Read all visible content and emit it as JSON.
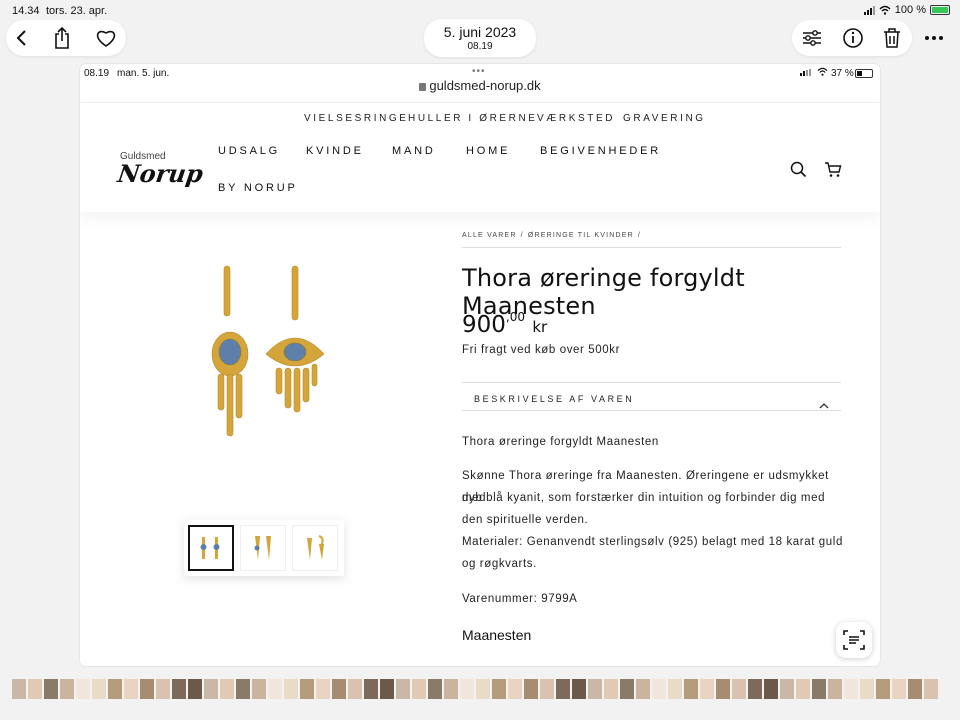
{
  "ipad_status": {
    "time": "14.34",
    "date": "tors. 23. apr.",
    "battery": "100 %"
  },
  "photos_toolbar": {
    "date_title": "5. juni 2023",
    "time_sub": "08.19",
    "left_icons": [
      "back-icon",
      "share-icon",
      "heart-icon"
    ],
    "right_icons": [
      "adjust-icon",
      "info-icon",
      "trash-icon",
      "more-icon"
    ]
  },
  "screenshot": {
    "status": {
      "time": "08.19",
      "date": "man. 5. jun.",
      "battery": "37 %"
    },
    "url": "guldsmed-norup.dk",
    "top_nav": [
      "VIELSESRINGE",
      "HULLER I ØRERNE",
      "VÆRKSTED",
      "GRAVERING"
    ],
    "main_nav": [
      "UDSALG",
      "KVINDE",
      "MAND",
      "HOME",
      "BEGIVENHEDER",
      "BY NORUP"
    ],
    "logo": {
      "small": "Guldsmed",
      "big": "Norup"
    },
    "breadcrumb": [
      "ALLE VARER",
      "/",
      "ØRERINGE TIL KVINDER",
      "/"
    ],
    "product": {
      "title": "Thora øreringe forgyldt Maanesten",
      "price_main": "900",
      "price_decimals": ",00",
      "currency": "kr",
      "shipping": "Fri fragt ved køb over 500kr",
      "description_toggle": "BESKRIVELSE AF VAREN",
      "desc_title": "Thora øreringe forgyldt Maanesten",
      "desc_lines": [
        "Skønne Thora øreringe fra Maanesten. Øreringene er udsmykket med",
        "dyb blå kyanit, som forstærker din intuition og forbinder dig med",
        "den spirituelle verden.",
        "Materialer: Genanvendt sterlingsølv (925) belagt med 18 karat guld",
        "og røgkvarts."
      ],
      "sku": "Varenummer: 9799A",
      "brand_heading": "Maanesten"
    },
    "colors": {
      "gold": "#d4a53a",
      "stone": "#5d7fa8"
    }
  }
}
